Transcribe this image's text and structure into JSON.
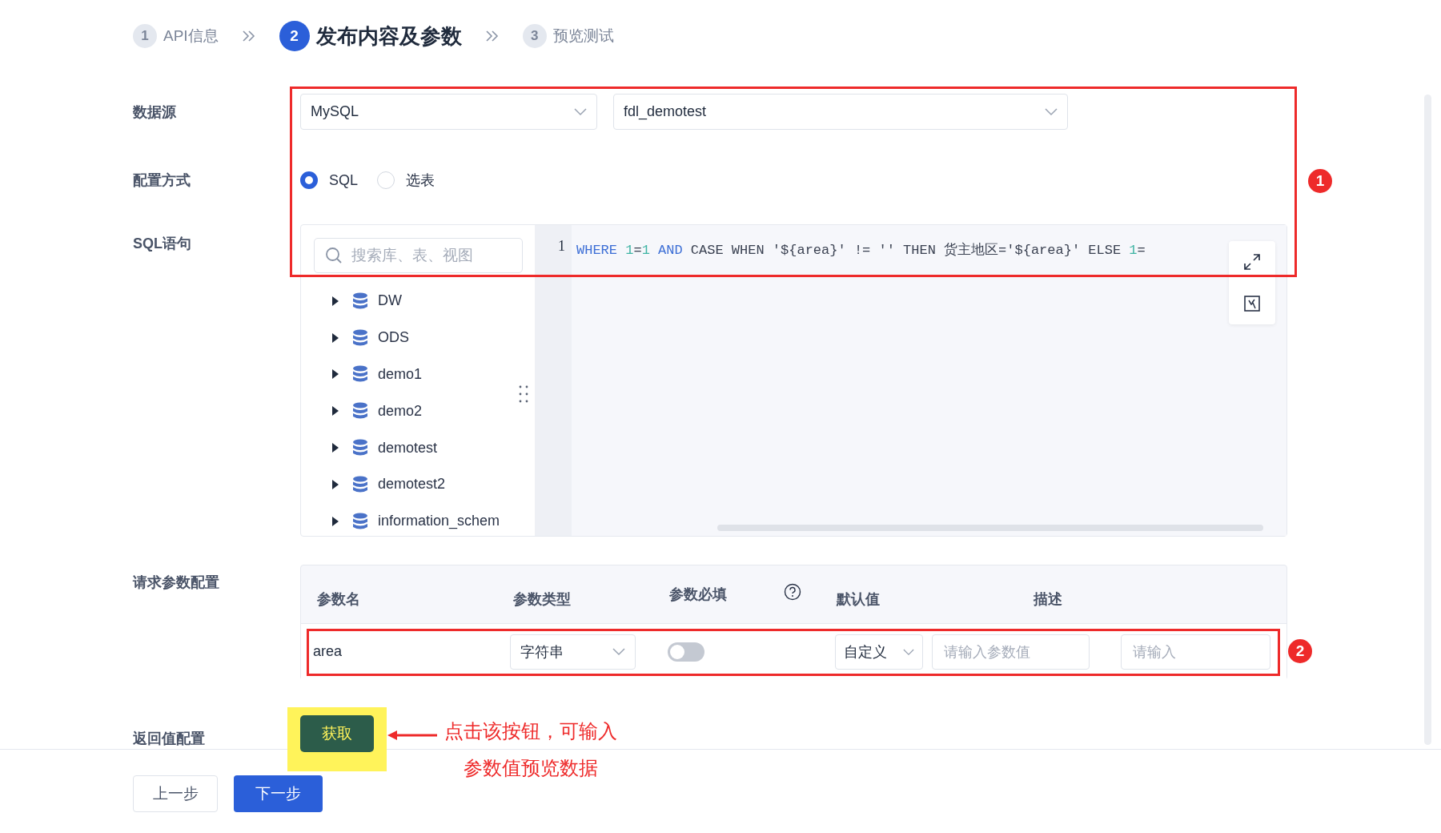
{
  "steps": [
    {
      "number": "1",
      "label": "API信息",
      "selected": false
    },
    {
      "number": "2",
      "label": "发布内容及参数",
      "selected": true
    },
    {
      "number": "3",
      "label": "预览测试",
      "selected": false
    }
  ],
  "datasource": {
    "label": "数据源",
    "type_select": "MySQL",
    "db_select": "fdl_demotest"
  },
  "config_mode": {
    "label": "配置方式",
    "options": [
      {
        "label": "SQL",
        "selected": true
      },
      {
        "label": "选表",
        "selected": false
      }
    ]
  },
  "sql": {
    "label": "SQL语句",
    "search_placeholder": "搜索库、表、视图",
    "tree": [
      {
        "name": "DW",
        "expanded": false
      },
      {
        "name": "ODS",
        "expanded": false
      },
      {
        "name": "demo1",
        "expanded": false
      },
      {
        "name": "demo2",
        "expanded": false
      },
      {
        "name": "demotest",
        "expanded": false
      },
      {
        "name": "demotest2",
        "expanded": false
      },
      {
        "name": "information_schem",
        "expanded": false
      }
    ],
    "line_number": "1",
    "tokens": [
      {
        "kind": "keyword",
        "text": "WHERE"
      },
      {
        "kind": "number",
        "text": " 1"
      },
      {
        "kind": "plain",
        "text": "="
      },
      {
        "kind": "number",
        "text": "1"
      },
      {
        "kind": "keyword",
        "text": " AND"
      },
      {
        "kind": "plain",
        "text": " CASE WHEN '${area}' != '' THEN 货主地区='${area}' ELSE "
      },
      {
        "kind": "number",
        "text": "1"
      },
      {
        "kind": "plain",
        "text": "="
      }
    ]
  },
  "params": {
    "label": "请求参数配置",
    "columns": [
      "参数名",
      "参数类型",
      "参数必填",
      "默认值",
      "描述"
    ],
    "rows": [
      {
        "name": "area",
        "type": "字符串",
        "required": false,
        "default_mode": "自定义",
        "value_placeholder": "请输入参数值",
        "desc_placeholder": "请输入"
      }
    ]
  },
  "return_config": {
    "label": "返回值配置",
    "button": "获取"
  },
  "footer": [
    {
      "kind": "secondary",
      "label": "上一步"
    },
    {
      "kind": "primary",
      "label": "下一步"
    }
  ],
  "annotations": {
    "badges": [
      "1",
      "2"
    ],
    "note": [
      "点击该按钮，可输入",
      "参数值预览数据"
    ]
  }
}
